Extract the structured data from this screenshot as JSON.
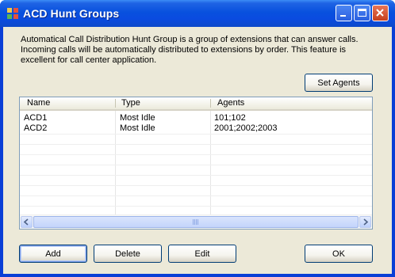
{
  "window": {
    "title": "ACD Hunt Groups",
    "controls": [
      "minimize",
      "maximize",
      "close"
    ]
  },
  "description": "Automatical Call Distribution Hunt Group is a group of extensions that can answer calls. Incoming calls will be automatically distributed to extensions by order.  This feature is excellent for call center application.",
  "buttons": {
    "set_agents": "Set Agents",
    "add": "Add",
    "delete": "Delete",
    "edit": "Edit",
    "ok": "OK"
  },
  "list": {
    "columns": [
      "Name",
      "Type",
      "Agents"
    ],
    "rows": [
      {
        "name": "ACD1",
        "type": "Most Idle",
        "agents": "101;102"
      },
      {
        "name": "ACD2",
        "type": "Most Idle",
        "agents": "2001;2002;2003"
      }
    ]
  },
  "colors": {
    "titlebar": "#0851de",
    "dialog_bg": "#ece9d8",
    "button_border": "#003c74"
  }
}
